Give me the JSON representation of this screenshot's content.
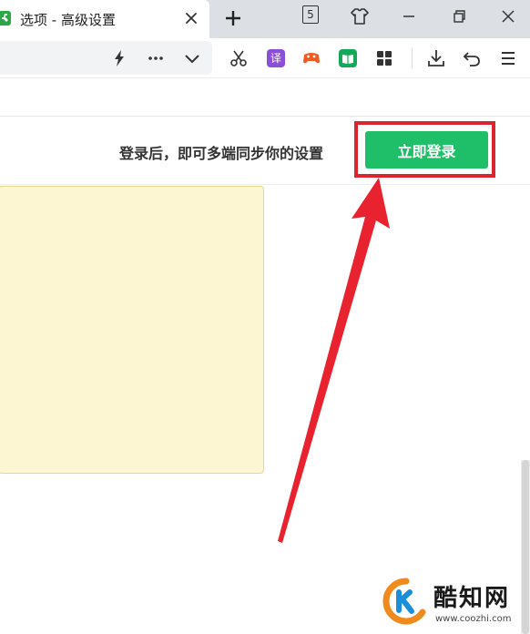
{
  "browser": {
    "tab": {
      "title": "选项 - 高级设置",
      "favicon": "wrench-icon",
      "close_icon": "close-icon"
    },
    "new_tab_icon": "plus-icon",
    "tab_count": "5",
    "window_controls": [
      "skin-icon",
      "minimize-icon",
      "restore-icon",
      "close-icon"
    ],
    "toolbar_icons": [
      "lightning-icon",
      "more-icon",
      "chevron-down-icon",
      "scissors-icon",
      "translate-icon",
      "game-icon",
      "book-icon",
      "apps-icon",
      "download-icon",
      "undo-icon",
      "menu-icon"
    ],
    "translate_label": "译"
  },
  "settings": {
    "sync_text": "登录后，即可多端同步你的设置",
    "login_button_label": "立即登录"
  },
  "colors": {
    "login_green": "#1fbf6a",
    "highlight_red": "#d9252f",
    "notice_bg": "#fdf6d3"
  },
  "watermark": {
    "name": "酷知网",
    "url": "www.coozhi.com"
  }
}
